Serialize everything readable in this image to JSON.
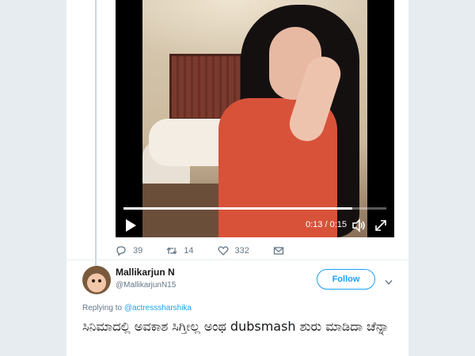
{
  "video": {
    "current_time": "0:13",
    "duration": "0:15",
    "time_display": "0:13 / 0:15",
    "progress": 0.87,
    "icons": {
      "play": "play-icon",
      "volume": "volume-icon",
      "fullscreen": "fullscreen-icon"
    }
  },
  "actions": {
    "reply": {
      "icon": "reply-icon",
      "count": "39"
    },
    "retweet": {
      "icon": "retweet-icon",
      "count": "14"
    },
    "like": {
      "icon": "heart-icon",
      "count": "332"
    },
    "dm": {
      "icon": "mail-icon"
    }
  },
  "reply_tweet": {
    "name": "Mallikarjun N",
    "handle": "@MallikarjunN15",
    "follow_label": "Follow",
    "replying_prefix": "Replying to",
    "replying_to": "@actresssharshika",
    "text": "ಸಿನಿಮಾದಲ್ಲಿ ಅವಕಾಶ ಸಿಗ್ತೀಲ್ಲ ಅಂಥ dubsmash ಶುರು ಮಾಡಿದಾ ಚೆನ್ನಾ"
  },
  "colors": {
    "accent": "#1da1f2",
    "muted": "#657786",
    "text": "#14171a",
    "background": "#e6ecf0"
  }
}
